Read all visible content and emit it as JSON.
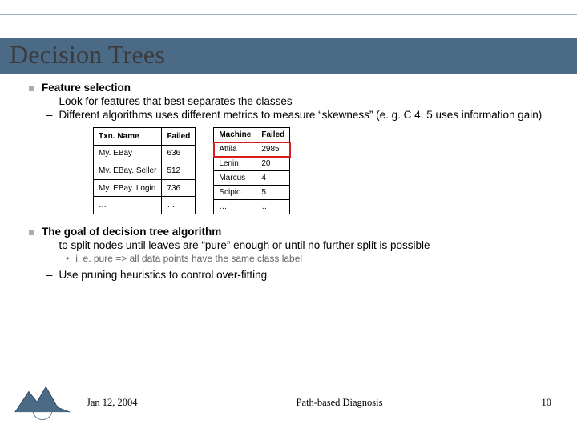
{
  "title": "Decision Trees",
  "bullets": {
    "b1": "Feature selection",
    "b1a": "Look for features that best separates the classes",
    "b1b": "Different algorithms uses different metrics to measure “skewness” (e. g. C 4. 5 uses information gain)",
    "b2": "The goal of decision tree algorithm",
    "b2a": "to split nodes until leaves are “pure” enough or until no further split is possible",
    "b2a1": "i. e. pure => all data points have the same class label",
    "b2b": "Use pruning heuristics to control over-fitting"
  },
  "table1": {
    "headers": [
      "Txn. Name",
      "Failed"
    ],
    "rows": [
      [
        "My. EBay",
        "636"
      ],
      [
        "My. EBay. Seller",
        "512"
      ],
      [
        "My. EBay. Login",
        "736"
      ],
      [
        "…",
        "…"
      ]
    ]
  },
  "table2": {
    "headers": [
      "Machine",
      "Failed"
    ],
    "rows": [
      [
        "Attila",
        "2985"
      ],
      [
        "Lenin",
        "20"
      ],
      [
        "Marcus",
        "4"
      ],
      [
        "Scipio",
        "5"
      ],
      [
        "…",
        "…"
      ]
    ]
  },
  "footer": {
    "date": "Jan 12, 2004",
    "center": "Path-based Diagnosis",
    "page": "10"
  }
}
